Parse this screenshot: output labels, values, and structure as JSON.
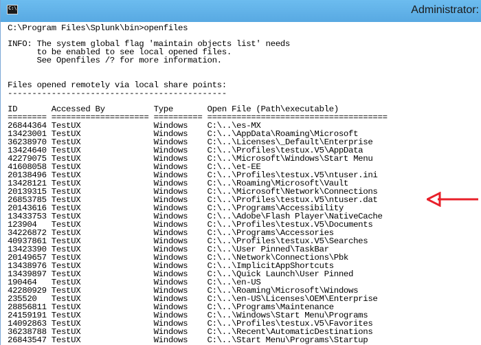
{
  "window": {
    "title": "Administrator:",
    "icon_label": "C:\\"
  },
  "console": {
    "command": "C:\\Program Files\\Splunk\\bin>openfiles",
    "info_lines": [
      "INFO: The system global flag 'maintain objects list' needs",
      "      to be enabled to see local opened files.",
      "      See Openfiles /? for more information."
    ],
    "section_title": "Files opened remotely via local share points:",
    "section_rule": "---------------------------------------------",
    "header": "ID       Accessed By          Type       Open File (Path\\executable)",
    "header_rule": "======== ==================== ========== =====================================",
    "rows": [
      "26844364 TestUX               Windows    C:\\..\\es-MX",
      "13423001 TestUX               Windows    C:\\..\\AppData\\Roaming\\Microsoft",
      "36238970 TestUX               Windows    C:\\..\\Licenses\\_Default\\Enterprise",
      "13424640 TestUX               Windows    C:\\..\\Profiles\\testux.V5\\AppData",
      "42279075 TestUX               Windows    C:\\..\\Microsoft\\Windows\\Start Menu",
      "41608058 TestUX               Windows    C:\\..\\et-EE",
      "20138496 TestUX               Windows    C:\\..\\Profiles\\testux.V5\\ntuser.ini",
      "13428121 TestUX               Windows    C:\\..\\Roaming\\Microsoft\\Vault",
      "20139315 TestUX               Windows    C:\\..\\Microsoft\\Network\\Connections",
      "26853785 TestUX               Windows    C:\\..\\Profiles\\testux.V5\\ntuser.dat",
      "20143616 TestUX               Windows    C:\\..\\Programs\\Accessibility",
      "13433753 TestUX               Windows    C:\\..\\Adobe\\Flash Player\\NativeCache",
      "123904   TestUX               Windows    C:\\..\\Profiles\\testux.V5\\Documents",
      "34226872 TestUX               Windows    C:\\..\\Programs\\Accessories",
      "40937861 TestUX               Windows    C:\\..\\Profiles\\testux.V5\\Searches",
      "13423390 TestUX               Windows    C:\\..\\User Pinned\\TaskBar",
      "20149657 TestUX               Windows    C:\\..\\Network\\Connections\\Pbk",
      "13438976 TestUX               Windows    C:\\..\\ImplicitAppShortcuts",
      "13439897 TestUX               Windows    C:\\..\\Quick Launch\\User Pinned",
      "190464   TestUX               Windows    C:\\..\\en-US",
      "42280929 TestUX               Windows    C:\\..\\Roaming\\Microsoft\\Windows",
      "235520   TestUX               Windows    C:\\..\\en-US\\Licenses\\OEM\\Enterprise",
      "28856811 TestUX               Windows    C:\\..\\Programs\\Maintenance",
      "24159191 TestUX               Windows    C:\\..\\Windows\\Start Menu\\Programs",
      "14092863 TestUX               Windows    C:\\..\\Profiles\\testux.V5\\Favorites",
      "36238788 TestUX               Windows    C:\\..\\Recent\\AutomaticDestinations",
      "26843547 TestUX               Windows    C:\\..\\Start Menu\\Programs\\Startup"
    ]
  },
  "annotation": {
    "arrow_color": "#e8202a",
    "points_to_row": "26853785"
  }
}
